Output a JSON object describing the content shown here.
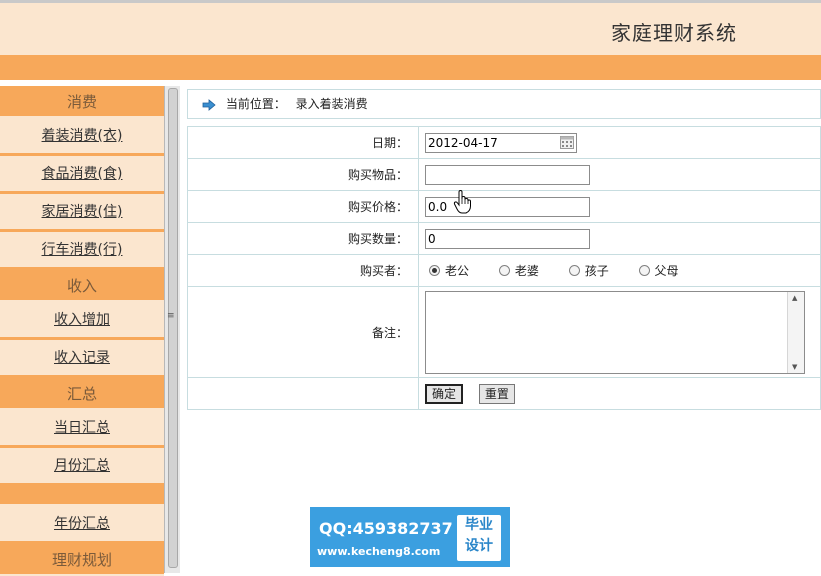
{
  "header": {
    "title": "家庭理财系统"
  },
  "sidebar": {
    "sections": [
      {
        "title": "消费",
        "items": [
          "着装消费(衣)",
          "食品消费(食)",
          "家居消费(住)",
          "行车消费(行)"
        ]
      },
      {
        "title": "收入",
        "items": [
          "收入增加",
          "收入记录"
        ]
      },
      {
        "title": "汇总",
        "items": [
          "当日汇总",
          "月份汇总"
        ]
      },
      {
        "title": "",
        "items": [
          "年份汇总"
        ]
      },
      {
        "title": "理财规划",
        "items": []
      }
    ]
  },
  "breadcrumb": {
    "prefix": "当前位置：",
    "page": "录入着装消费"
  },
  "form": {
    "date_label": "日期：",
    "date_value": "2012-04-17",
    "item_label": "购买物品：",
    "item_value": "",
    "price_label": "购买价格：",
    "price_value": "0.0",
    "qty_label": "购买数量：",
    "qty_value": "0",
    "buyer_label": "购买者：",
    "buyer_options": [
      "老公",
      "老婆",
      "孩子",
      "父母"
    ],
    "buyer_selected": "老公",
    "notes_label": "备注：",
    "notes_value": "",
    "submit_label": "确定",
    "reset_label": "重置"
  },
  "watermark": {
    "qq": "QQ:459382737",
    "url": "www.kecheng8.com",
    "badge_line1": "毕业",
    "badge_line2": "设计"
  },
  "colors": {
    "header_bg": "#fbe6cf",
    "accent_orange": "#f7a85a",
    "table_border": "#c7dde0",
    "watermark_blue": "#3b9fe0"
  },
  "icons": {
    "breadcrumb": "arrow-right-icon",
    "date": "calendar-icon",
    "cursor": "hand-cursor-icon"
  }
}
